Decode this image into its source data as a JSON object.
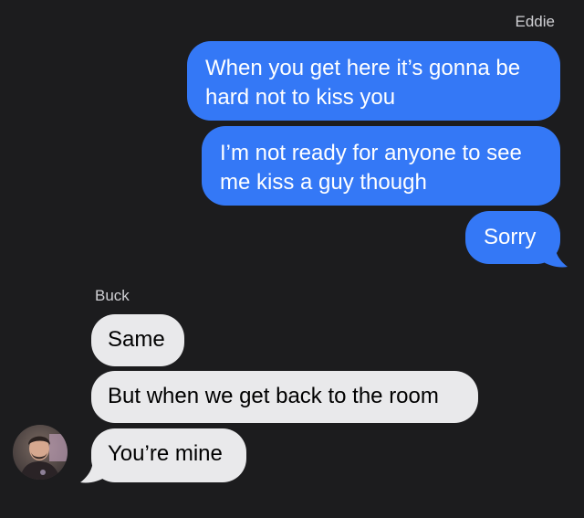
{
  "conversation": {
    "outgoing_sender": "Eddie",
    "incoming_sender": "Buck",
    "outgoing_messages": [
      {
        "text": "When you get here it’s gonna be hard not to kiss you"
      },
      {
        "text": "I’m not ready for anyone to see me kiss a guy though"
      },
      {
        "text": "Sorry"
      }
    ],
    "incoming_messages": [
      {
        "text": "Same"
      },
      {
        "text": "But when we get back to the room"
      },
      {
        "text": "You’re mine"
      }
    ]
  },
  "colors": {
    "background": "#1c1c1e",
    "sent_bubble": "#3478f6",
    "received_bubble": "#e9e9eb",
    "sender_name": "#d0d0d4"
  },
  "icons": {
    "avatar": "contact-avatar-photo"
  }
}
